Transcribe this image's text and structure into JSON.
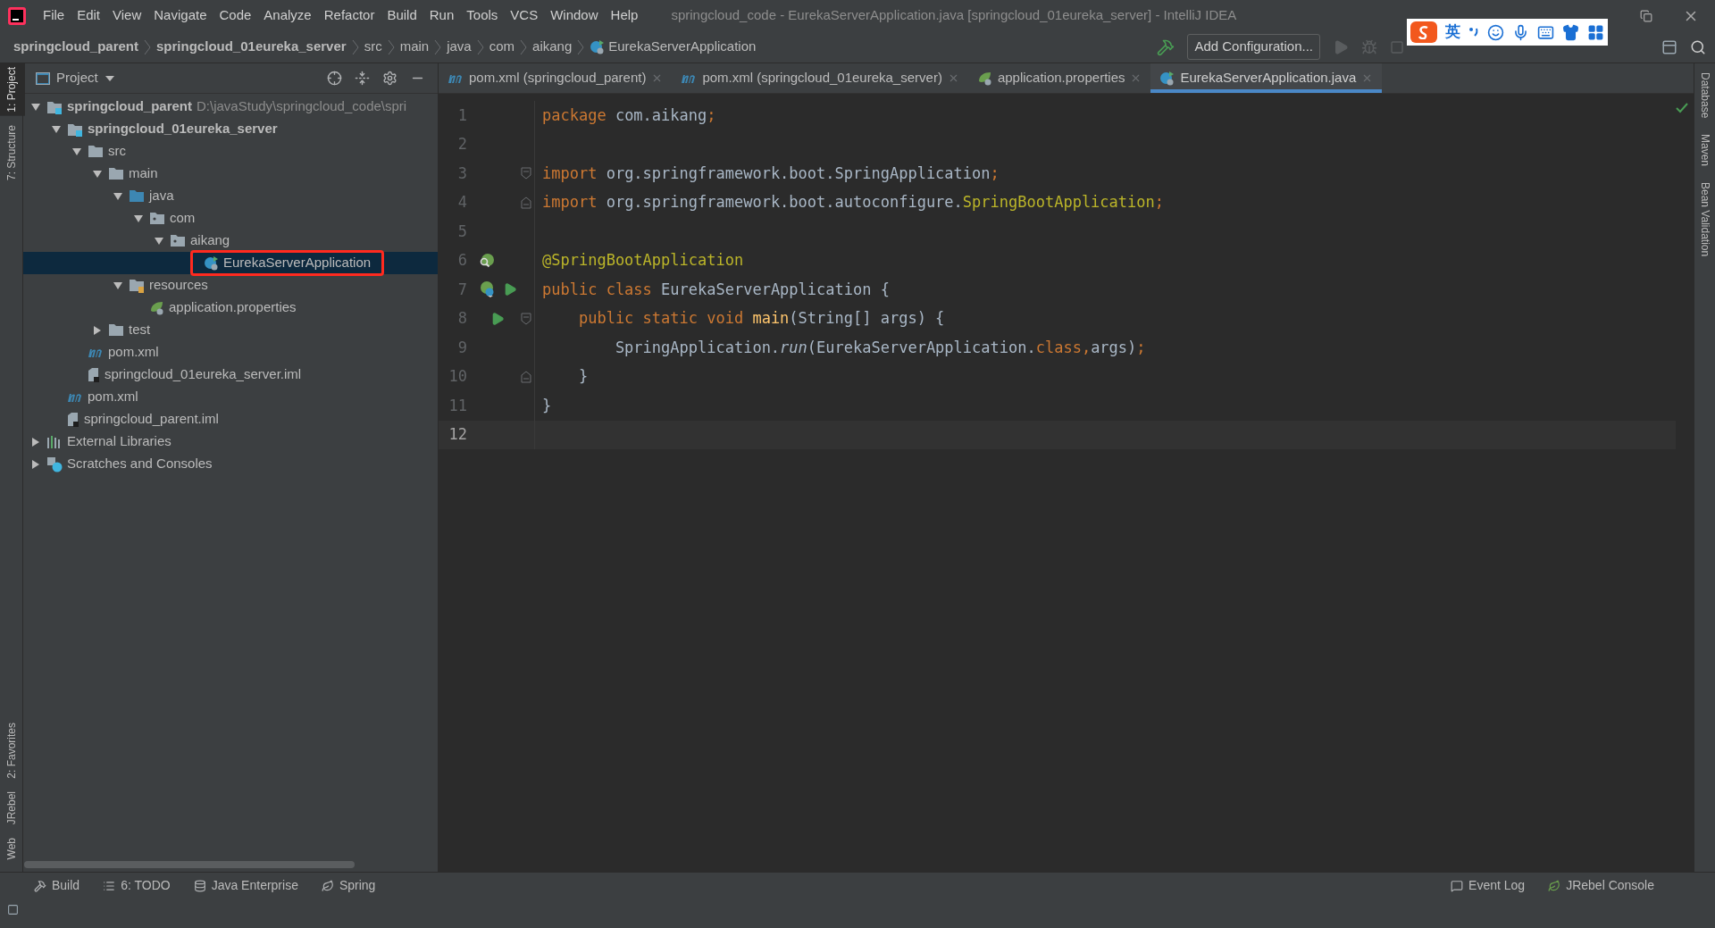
{
  "window": {
    "title": "springcloud_code - EurekaServerApplication.java [springcloud_01eureka_server] - IntelliJ IDEA"
  },
  "menu": [
    "File",
    "Edit",
    "View",
    "Navigate",
    "Code",
    "Analyze",
    "Refactor",
    "Build",
    "Run",
    "Tools",
    "VCS",
    "Window",
    "Help"
  ],
  "breadcrumbs": [
    {
      "label": "springcloud_parent",
      "kind": "module"
    },
    {
      "label": "springcloud_01eureka_server",
      "kind": "module"
    },
    {
      "label": "src",
      "kind": "folder"
    },
    {
      "label": "main",
      "kind": "folder"
    },
    {
      "label": "java",
      "kind": "folder"
    },
    {
      "label": "com",
      "kind": "folder"
    },
    {
      "label": "aikang",
      "kind": "folder"
    },
    {
      "label": "EurekaServerApplication",
      "kind": "class"
    }
  ],
  "toolbar": {
    "run_config": "Add Configuration..."
  },
  "ime_bar": {
    "mode": "英"
  },
  "left_strip": {
    "top": [
      {
        "label": "1: Project",
        "selected": true
      },
      {
        "label": "7: Structure",
        "selected": false
      }
    ],
    "bottom": [
      {
        "label": "2: Favorites",
        "selected": false
      },
      {
        "label": "JRebel",
        "selected": false
      },
      {
        "label": "Web",
        "selected": false
      }
    ]
  },
  "project_panel": {
    "title": "Project",
    "red_box_on_selected": true,
    "tree": [
      {
        "label": "springcloud_parent",
        "kind": "module",
        "hint": "D:\\javaStudy\\springcloud_code\\spri",
        "expanded": true,
        "selected": false,
        "children": [
          {
            "label": "springcloud_01eureka_server",
            "kind": "module",
            "expanded": true,
            "selected": false,
            "children": [
              {
                "label": "src",
                "kind": "folder",
                "expanded": true,
                "selected": false,
                "children": [
                  {
                    "label": "main",
                    "kind": "folder",
                    "expanded": true,
                    "selected": false,
                    "children": [
                      {
                        "label": "java",
                        "kind": "source_folder",
                        "expanded": true,
                        "selected": false,
                        "children": [
                          {
                            "label": "com",
                            "kind": "package",
                            "expanded": true,
                            "selected": false,
                            "children": [
                              {
                                "label": "aikang",
                                "kind": "package",
                                "expanded": true,
                                "selected": false,
                                "children": [
                                  {
                                    "label": "EurekaServerApplication",
                                    "kind": "class",
                                    "selected": true
                                  }
                                ]
                              }
                            ]
                          }
                        ]
                      },
                      {
                        "label": "resources",
                        "kind": "resources",
                        "expanded": true,
                        "selected": false,
                        "children": [
                          {
                            "label": "application.properties",
                            "kind": "properties",
                            "selected": false
                          }
                        ]
                      }
                    ]
                  },
                  {
                    "label": "test",
                    "kind": "folder",
                    "expanded": false,
                    "selected": false
                  }
                ]
              },
              {
                "label": "pom.xml",
                "kind": "maven",
                "selected": false
              },
              {
                "label": "springcloud_01eureka_server.iml",
                "kind": "iml",
                "selected": false
              }
            ]
          },
          {
            "label": "pom.xml",
            "kind": "maven",
            "selected": false
          },
          {
            "label": "springcloud_parent.iml",
            "kind": "iml",
            "selected": false
          }
        ]
      },
      {
        "label": "External Libraries",
        "kind": "libraries",
        "expanded": false,
        "selected": false
      },
      {
        "label": "Scratches and Consoles",
        "kind": "scratches",
        "expanded": false,
        "selected": false
      }
    ]
  },
  "tabs": [
    {
      "label": "pom.xml (springcloud_parent)",
      "kind": "maven",
      "selected": false
    },
    {
      "label": "pom.xml (springcloud_01eureka_server)",
      "kind": "maven",
      "selected": false
    },
    {
      "label": "application.properties",
      "kind": "properties",
      "selected": false
    },
    {
      "label": "EurekaServerApplication.java",
      "kind": "class",
      "selected": true
    }
  ],
  "editor": {
    "lines": [
      {
        "number": "1",
        "current": false,
        "tokens": [
          {
            "text": "package",
            "kind": "keyword"
          },
          {
            "text": " com.aikang",
            "kind": "plain"
          },
          {
            "text": ";",
            "kind": "keyword"
          }
        ]
      },
      {
        "number": "2",
        "current": false
      },
      {
        "number": "3",
        "current": false,
        "fold": {
          "kind": "start"
        },
        "tokens": [
          {
            "text": "import",
            "kind": "keyword"
          },
          {
            "text": " org.springframework.boot.SpringApplication",
            "kind": "plain"
          },
          {
            "text": ";",
            "kind": "keyword"
          }
        ]
      },
      {
        "number": "4",
        "current": false,
        "fold": {
          "kind": "end"
        },
        "tokens": [
          {
            "text": "import",
            "kind": "keyword"
          },
          {
            "text": " org.springframework.boot.autoconfigure.",
            "kind": "plain"
          },
          {
            "text": "SpringBootApplication",
            "kind": "annotation"
          },
          {
            "text": ";",
            "kind": "keyword"
          }
        ]
      },
      {
        "number": "5",
        "current": false
      },
      {
        "number": "6",
        "current": false,
        "gutter": {
          "kind": "bean_search"
        },
        "tokens": [
          {
            "text": "@SpringBootApplication",
            "kind": "annotation"
          }
        ]
      },
      {
        "number": "7",
        "current": false,
        "gutter": {
          "kind": "bean_run"
        },
        "tokens": [
          {
            "text": "public class",
            "kind": "keyword"
          },
          {
            "text": " EurekaServerApplication {",
            "kind": "plain"
          }
        ]
      },
      {
        "number": "8",
        "current": false,
        "gutter": {
          "kind": "run"
        },
        "fold": {
          "kind": "start"
        },
        "tokens": [
          {
            "text": "    public static void",
            "kind": "keyword"
          },
          {
            "text": " main",
            "kind": "method"
          },
          {
            "text": "(String[] args) {",
            "kind": "plain"
          }
        ]
      },
      {
        "number": "9",
        "current": false,
        "tokens": [
          {
            "text": "        SpringApplication.",
            "kind": "plain"
          },
          {
            "text": "run",
            "kind": "static"
          },
          {
            "text": "(EurekaServerApplication.",
            "kind": "plain"
          },
          {
            "text": "class,",
            "kind": "keyword"
          },
          {
            "text": "args)",
            "kind": "plain"
          },
          {
            "text": ";",
            "kind": "keyword"
          }
        ]
      },
      {
        "number": "10",
        "current": false,
        "fold": {
          "kind": "end"
        },
        "tokens": [
          {
            "text": "    }",
            "kind": "plain"
          }
        ]
      },
      {
        "number": "11",
        "current": false,
        "tokens": [
          {
            "text": "}",
            "kind": "plain"
          }
        ]
      },
      {
        "number": "12",
        "current": true
      }
    ]
  },
  "right_strip": [
    "Database",
    "Maven",
    "Bean Validation"
  ],
  "bottom_tools": [
    {
      "label": "Build",
      "kind": "build"
    },
    {
      "label": "6: TODO",
      "kind": "todo"
    },
    {
      "label": "Java Enterprise",
      "kind": "enterprise"
    },
    {
      "label": "Spring",
      "kind": "spring"
    }
  ],
  "bottom_right_tools": [
    {
      "label": "Event Log",
      "kind": "log"
    },
    {
      "label": "JRebel Console",
      "kind": "jrebel"
    }
  ]
}
